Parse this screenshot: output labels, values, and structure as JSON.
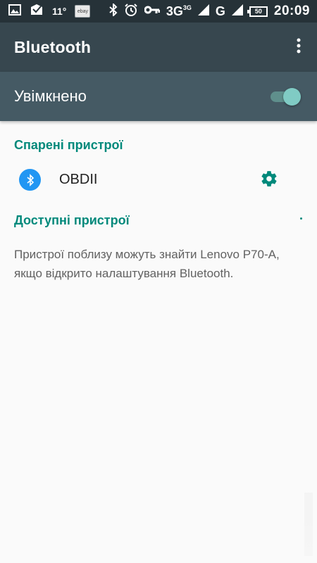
{
  "status_bar": {
    "temperature": "11°",
    "ebay_label": "ebay",
    "network_3g": "3G",
    "network_3g_sup": "3G",
    "network_g": "G",
    "battery_level": "50",
    "time": "20:09"
  },
  "app_bar": {
    "title": "Bluetooth",
    "more_icon": "more-vert-icon"
  },
  "toggle": {
    "label": "Увімкнено",
    "state": "on",
    "accent_color": "#80cbc4"
  },
  "paired": {
    "header": "Спарені пристрої",
    "devices": [
      {
        "name": "OBDII",
        "icon": "bluetooth-icon",
        "settings_icon": "gear-icon"
      }
    ]
  },
  "available": {
    "header": "Доступні пристрої",
    "info": "Пристрої поблизу можуть знайти Lenovo P70-A, якщо відкрито налаштування Bluetooth."
  },
  "colors": {
    "status_bar": "#263238",
    "app_bar": "#37474f",
    "toggle_band": "#455a64",
    "section_header": "#00897b",
    "device_icon_bg": "#2196f3"
  }
}
